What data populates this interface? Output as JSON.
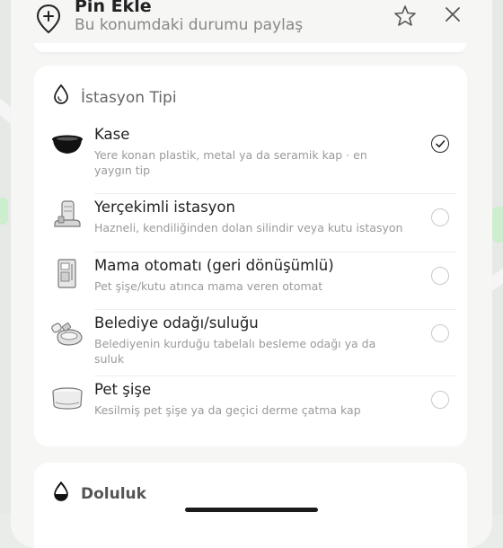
{
  "header": {
    "title": "Pin Ekle",
    "subtitle": "Bu konumdaki durumu paylaş"
  },
  "station_type": {
    "title": "İstasyon Tipi",
    "options": [
      {
        "label": "Kase",
        "description": "Yere konan plastik, metal ya da seramik kap · en yaygın tip",
        "selected": true,
        "icon": "bowl-icon"
      },
      {
        "label": "Yerçekimli istasyon",
        "description": "Hazneli, kendiliğinden dolan silindir veya kutu istasyon",
        "selected": false,
        "icon": "gravity-feeder-icon"
      },
      {
        "label": "Mama otomatı (geri dönüşümlü)",
        "description": "Pet şişe/kutu atınca mama veren otomat",
        "selected": false,
        "icon": "vending-machine-icon"
      },
      {
        "label": "Belediye odağı/suluğu",
        "description": "Belediyenin kurduğu tabelalı besleme odağı ya da suluk",
        "selected": false,
        "icon": "municipal-feeder-icon"
      },
      {
        "label": "Pet şişe",
        "description": "Kesilmiş pet şişe ya da geçici derme çatma kap",
        "selected": false,
        "icon": "cut-bottle-icon"
      }
    ]
  },
  "fullness": {
    "title": "Doluluk"
  },
  "colors": {
    "sheet_background": "#f6f6f5",
    "card_background": "#ffffff",
    "text_primary": "#222222",
    "text_secondary": "#9a9a9a",
    "map_green": "#cdeecd"
  }
}
